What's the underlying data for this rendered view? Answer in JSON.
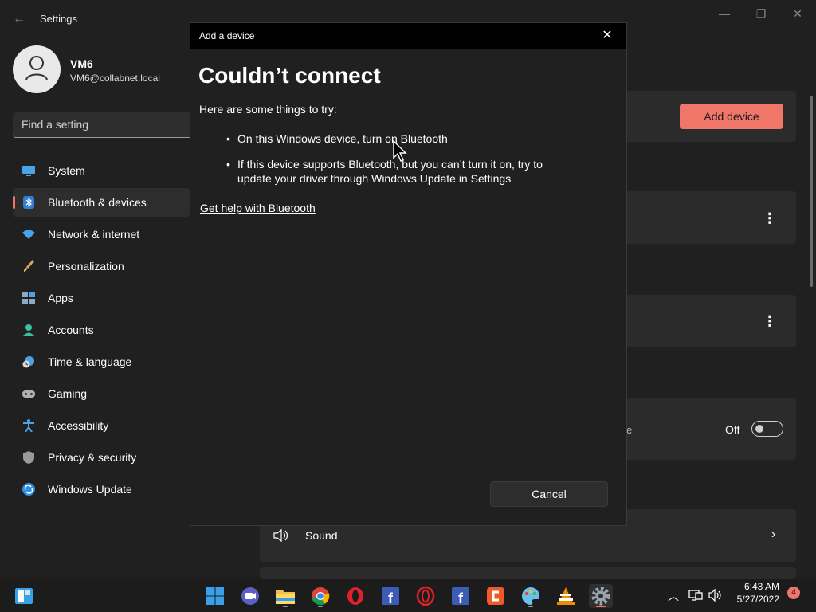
{
  "window": {
    "title": "Settings",
    "back": "←"
  },
  "user": {
    "name": "VM6",
    "email": "VM6@collabnet.local"
  },
  "search": {
    "placeholder": "Find a setting"
  },
  "sidebar": {
    "items": [
      {
        "label": "System",
        "icon": "system-icon"
      },
      {
        "label": "Bluetooth & devices",
        "icon": "bluetooth-icon",
        "active": true
      },
      {
        "label": "Network & internet",
        "icon": "wifi-icon"
      },
      {
        "label": "Personalization",
        "icon": "brush-icon"
      },
      {
        "label": "Apps",
        "icon": "apps-icon"
      },
      {
        "label": "Accounts",
        "icon": "account-icon"
      },
      {
        "label": "Time & language",
        "icon": "clock-globe-icon"
      },
      {
        "label": "Gaming",
        "icon": "gamepad-icon"
      },
      {
        "label": "Accessibility",
        "icon": "accessibility-icon"
      },
      {
        "label": "Privacy & security",
        "icon": "shield-icon"
      },
      {
        "label": "Windows Update",
        "icon": "update-icon"
      }
    ]
  },
  "main": {
    "add_device_label": "Add device",
    "toggle_fragment": "e",
    "toggle_state": "Off",
    "sound_label": "Sound"
  },
  "dialog": {
    "title": "Add a device",
    "heading": "Couldn’t connect",
    "intro": "Here are some things to try:",
    "tips": [
      "On this Windows device, turn on Bluetooth",
      "If this device supports Bluetooth, but you can’t turn it on, try to update your driver through Windows Update in Settings"
    ],
    "link": "Get help with Bluetooth",
    "cancel_label": "Cancel"
  },
  "taskbar": {
    "time": "6:43 AM",
    "date": "5/27/2022",
    "notification_count": "4"
  },
  "colors": {
    "accent": "#f0766a",
    "background": "#202020",
    "card": "#2b2b2b",
    "dialog_titlebar": "#000000"
  }
}
